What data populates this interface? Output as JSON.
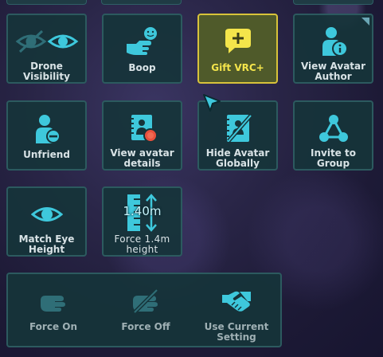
{
  "colors": {
    "accent": "#3ec8dc",
    "tile_bg": "#16343a",
    "tile_border": "#2c5a5f",
    "highlight_bg": "#4f5a2a",
    "highlight_border": "#d8c33a",
    "highlight_text": "#f4e54b",
    "dim_icon": "#2f6e77"
  },
  "tiles": [
    {
      "label": "Drone Visibility",
      "icon": "eye-toggle-icon"
    },
    {
      "label": "Boop",
      "icon": "boop-icon"
    },
    {
      "label": "Gift VRC+",
      "icon": "chat-plus-icon"
    },
    {
      "label": "View Avatar Author",
      "icon": "user-info-icon"
    },
    {
      "label": "Unfriend",
      "icon": "user-remove-icon"
    },
    {
      "label": "View avatar details",
      "icon": "avatar-details-icon"
    },
    {
      "label": "Hide Avatar Globally",
      "icon": "hide-avatar-icon"
    },
    {
      "label": "Invite to Group",
      "icon": "group-icon"
    },
    {
      "label": "Match Eye Height",
      "icon": "eye-icon"
    },
    {
      "label": "Force 1.4m height",
      "icon": "height-icon",
      "readout": "1.40m"
    }
  ],
  "force_group": [
    {
      "label": "Force On",
      "icon": "hand-icon"
    },
    {
      "label": "Force Off",
      "icon": "hand-off-icon"
    },
    {
      "label": "Use Current Setting",
      "icon": "handshake-icon"
    }
  ]
}
